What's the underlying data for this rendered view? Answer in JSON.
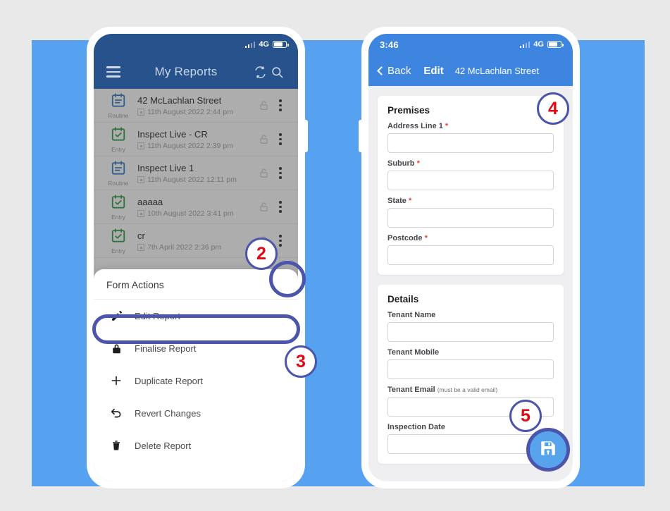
{
  "canvas": {
    "bg_color": "#e9e9e9",
    "panel_color": "#56a2f0"
  },
  "left_phone": {
    "status_bar": {
      "time": "",
      "network": "4G",
      "signal_icon": "signal-bars-icon",
      "battery_icon": "battery-icon"
    },
    "header": {
      "bg_color": "#27528c",
      "menu_icon": "hamburger-menu-icon",
      "title": "My Reports",
      "sync_icon": "sync-refresh-icon",
      "search_icon": "search-icon"
    },
    "reports": [
      {
        "name": "42 McLachlan Street",
        "date": "11th August 2022 2:44 pm",
        "type": "Routine",
        "type_color": "#2f79c7",
        "lock_icon": "unlocked-padlock-icon",
        "menu_icon": "overflow-dots-icon"
      },
      {
        "name": "Inspect Live - CR",
        "date": "11th August 2022 2:39 pm",
        "type": "Entry",
        "type_color": "#2f9a3e",
        "lock_icon": "unlocked-padlock-icon",
        "menu_icon": "overflow-dots-icon"
      },
      {
        "name": "Inspect Live 1",
        "date": "11th August 2022 12:11 pm",
        "type": "Routine",
        "type_color": "#2f79c7",
        "lock_icon": "unlocked-padlock-icon",
        "menu_icon": "overflow-dots-icon"
      },
      {
        "name": "aaaaa",
        "date": "10th August 2022 3:41 pm",
        "type": "Entry",
        "type_color": "#2f9a3e",
        "lock_icon": "unlocked-padlock-icon",
        "menu_icon": "overflow-dots-icon"
      },
      {
        "name": "cr",
        "date": "7th April 2022 2:36 pm",
        "type": "Entry",
        "type_color": "#2f9a3e",
        "lock_icon": "unlocked-padlock-icon",
        "menu_icon": "overflow-dots-icon"
      }
    ],
    "action_sheet": {
      "title": "Form Actions",
      "items": [
        {
          "label": "Edit Report",
          "icon": "pencil-edit-icon"
        },
        {
          "label": "Finalise Report",
          "icon": "padlock-closed-icon"
        },
        {
          "label": "Duplicate Report",
          "icon": "plus-icon"
        },
        {
          "label": "Revert Changes",
          "icon": "undo-arrow-icon"
        },
        {
          "label": "Delete Report",
          "icon": "trash-bin-icon"
        }
      ]
    }
  },
  "right_phone": {
    "status_bar": {
      "time": "3:46",
      "network": "4G",
      "signal_icon": "signal-bars-icon",
      "battery_icon": "battery-icon"
    },
    "header": {
      "bg_color": "#3d85de",
      "back_icon": "chevron-left-icon",
      "back_label": "Back",
      "edit_label": "Edit",
      "address": "42 McLachlan Street"
    },
    "premises_card": {
      "title": "Premises",
      "fields": [
        {
          "label": "Address Line 1",
          "required": true,
          "value": "",
          "hint": ""
        },
        {
          "label": "Suburb",
          "required": true,
          "value": "",
          "hint": ""
        },
        {
          "label": "State",
          "required": true,
          "value": "",
          "hint": ""
        },
        {
          "label": "Postcode",
          "required": true,
          "value": "",
          "hint": ""
        }
      ]
    },
    "details_card": {
      "title": "Details",
      "fields": [
        {
          "label": "Tenant Name",
          "required": false,
          "value": "",
          "hint": ""
        },
        {
          "label": "Tenant Mobile",
          "required": false,
          "value": "",
          "hint": ""
        },
        {
          "label": "Tenant Email",
          "required": false,
          "value": "",
          "hint": "(must be a valid email)"
        },
        {
          "label": "Inspection Date",
          "required": false,
          "value": "",
          "hint": ""
        }
      ]
    },
    "save_fab": {
      "icon": "save-floppy-disk-icon",
      "bg_color": "#57a3ec",
      "ring_color": "#4b55ab"
    }
  },
  "callouts": [
    {
      "number": "2",
      "target": "report-row-overflow-menu"
    },
    {
      "number": "3",
      "target": "form-actions-sheet"
    },
    {
      "number": "4",
      "target": "premises-card"
    },
    {
      "number": "5",
      "target": "save-fab"
    }
  ],
  "highlight_color": "#4b55ab",
  "callout_number_color": "#e30613"
}
